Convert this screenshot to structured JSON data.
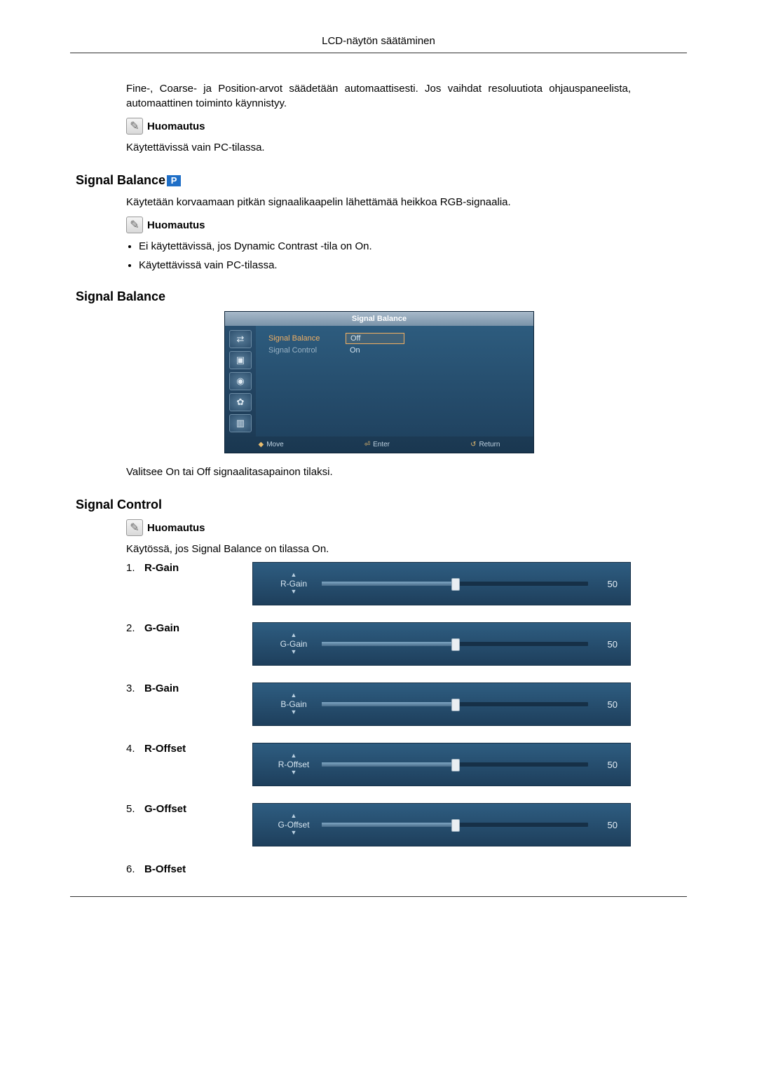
{
  "header": {
    "title": "LCD-näytön säätäminen"
  },
  "intro": {
    "para": "Fine-, Coarse- ja Position-arvot säädetään automaattisesti. Jos vaihdat resoluutiota ohjauspaneelista, automaattinen toiminto käynnistyy.",
    "note_label": "Huomautus",
    "note_body": "Käytettävissä vain PC-tilassa."
  },
  "sigbal1": {
    "heading": "Signal Balance",
    "badge": "P",
    "desc": "Käytetään korvaamaan pitkän signaalikaapelin lähettämää heikkoa RGB-signaalia.",
    "note_label": "Huomautus",
    "bullets": [
      "Ei käytettävissä, jos Dynamic Contrast -tila on On.",
      "Käytettävissä vain PC-tilassa."
    ]
  },
  "sigbal2": {
    "heading": "Signal Balance",
    "osd": {
      "title": "Signal Balance",
      "row1_label": "Signal Balance",
      "row2_label": "Signal Control",
      "opt_off": "Off",
      "opt_on": "On",
      "footer_move": "Move",
      "footer_enter": "Enter",
      "footer_return": "Return"
    },
    "after": "Valitsee On tai Off signaalitasapainon tilaksi."
  },
  "sigctrl": {
    "heading": "Signal Control",
    "note_label": "Huomautus",
    "note_body": "Käytössä, jos Signal Balance on tilassa On.",
    "items": [
      {
        "num": "1.",
        "label": "R-Gain",
        "slider_label": "R-Gain",
        "value": "50"
      },
      {
        "num": "2.",
        "label": "G-Gain",
        "slider_label": "G-Gain",
        "value": "50"
      },
      {
        "num": "3.",
        "label": "B-Gain",
        "slider_label": "B-Gain",
        "value": "50"
      },
      {
        "num": "4.",
        "label": "R-Offset",
        "slider_label": "R-Offset",
        "value": "50"
      },
      {
        "num": "5.",
        "label": "G-Offset",
        "slider_label": "G-Offset",
        "value": "50"
      },
      {
        "num": "6.",
        "label": "B-Offset",
        "slider_label": "",
        "value": ""
      }
    ]
  }
}
